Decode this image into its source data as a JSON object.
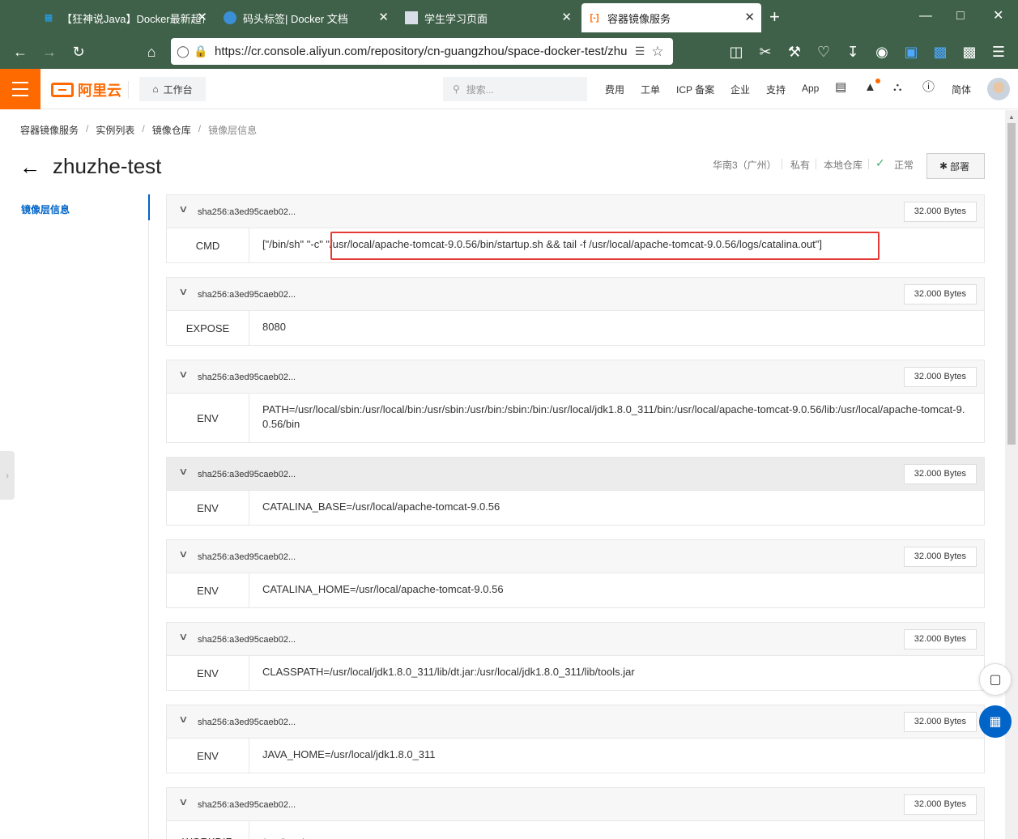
{
  "browser": {
    "tabs": [
      {
        "label": "【狂神说Java】Docker最新超详",
        "icon": "bilibili-icon",
        "active": false
      },
      {
        "label": "码头标签| Docker 文档",
        "icon": "docker-docs-icon",
        "active": false
      },
      {
        "label": "学生学习页面",
        "icon": "page-icon",
        "active": false
      },
      {
        "label": "容器镜像服务",
        "icon": "aliyun-icon",
        "active": true
      }
    ],
    "new_tab": "+",
    "url": "https://cr.console.aliyun.com/repository/cn-guangzhou/space-docker-test/zhuzhe-test/images"
  },
  "header": {
    "logo_text": "阿里云",
    "workbench": "工作台",
    "search_placeholder": "搜索...",
    "nav": [
      "费用",
      "工单",
      "ICP 备案",
      "企业",
      "支持",
      "App"
    ],
    "lang": "简体"
  },
  "breadcrumb": [
    "容器镜像服务",
    "实例列表",
    "镜像仓库",
    "镜像层信息"
  ],
  "page": {
    "title": "zhuzhe-test",
    "region": "华南3（广州）",
    "visibility": "私有",
    "repo_type": "本地仓库",
    "status": "正常",
    "deploy_label": "部署"
  },
  "side_nav": {
    "active": "镜像层信息"
  },
  "layers": [
    {
      "digest": "sha256:a3ed95caeb02...",
      "size": "32.000 Bytes",
      "instruction": "CMD",
      "value": "[\"/bin/sh\" \"-c\" \"/usr/local/apache-tomcat-9.0.56/bin/startup.sh && tail -f /usr/local/apache-tomcat-9.0.56/logs/catalina.out\"]"
    },
    {
      "digest": "sha256:a3ed95caeb02...",
      "size": "32.000 Bytes",
      "instruction": "EXPOSE",
      "value": "8080"
    },
    {
      "digest": "sha256:a3ed95caeb02...",
      "size": "32.000 Bytes",
      "instruction": "ENV",
      "value": "PATH=/usr/local/sbin:/usr/local/bin:/usr/sbin:/usr/bin:/sbin:/bin:/usr/local/jdk1.8.0_311/bin:/usr/local/apache-tomcat-9.0.56/lib:/usr/local/apache-tomcat-9.0.56/bin"
    },
    {
      "digest": "sha256:a3ed95caeb02...",
      "size": "32.000 Bytes",
      "instruction": "ENV",
      "value": "CATALINA_BASE=/usr/local/apache-tomcat-9.0.56"
    },
    {
      "digest": "sha256:a3ed95caeb02...",
      "size": "32.000 Bytes",
      "instruction": "ENV",
      "value": "CATALINA_HOME=/usr/local/apache-tomcat-9.0.56"
    },
    {
      "digest": "sha256:a3ed95caeb02...",
      "size": "32.000 Bytes",
      "instruction": "ENV",
      "value": "CLASSPATH=/usr/local/jdk1.8.0_311/lib/dt.jar:/usr/local/jdk1.8.0_311/lib/tools.jar"
    },
    {
      "digest": "sha256:a3ed95caeb02...",
      "size": "32.000 Bytes",
      "instruction": "ENV",
      "value": "JAVA_HOME=/usr/local/jdk1.8.0_311"
    },
    {
      "digest": "sha256:a3ed95caeb02...",
      "size": "32.000 Bytes",
      "instruction": "WORKDIR",
      "value": "/usr/local"
    }
  ],
  "colors": {
    "brand": "#ff6a00",
    "link": "#0064c8",
    "highlight_border": "#e53935",
    "browser_chrome": "#3f6149"
  }
}
